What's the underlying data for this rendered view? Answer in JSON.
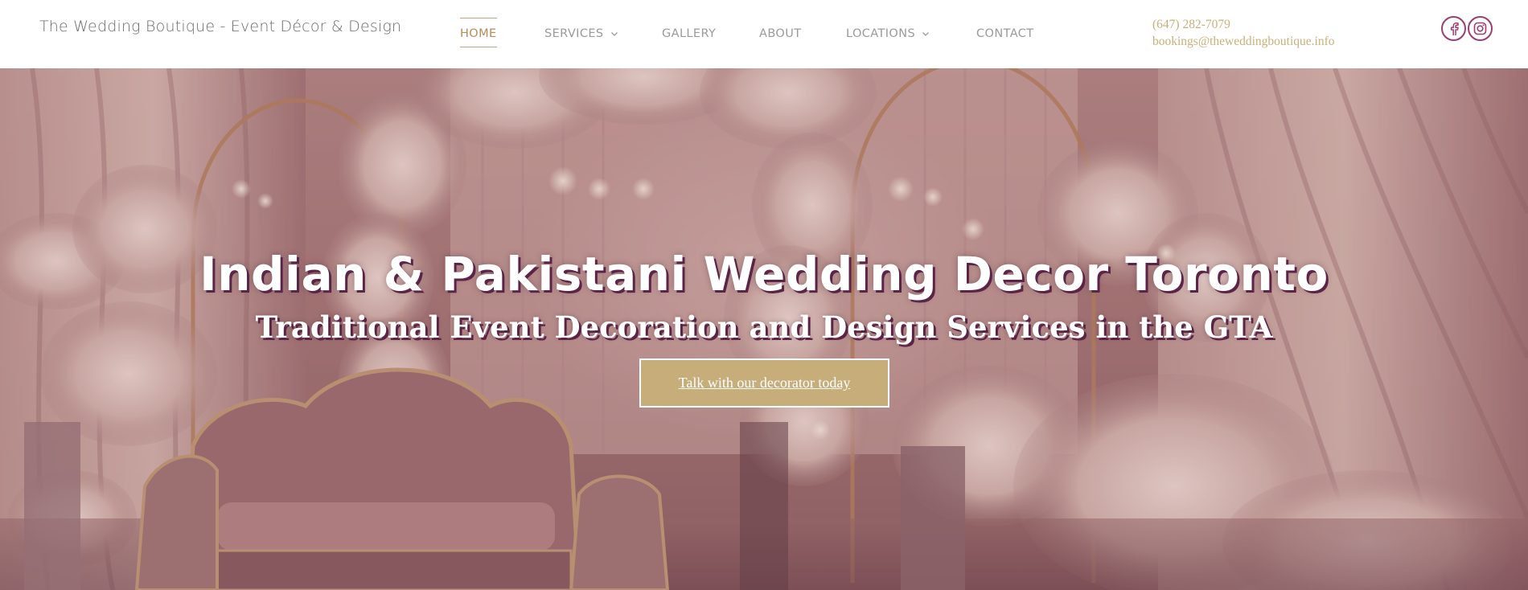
{
  "brand": {
    "title": "The Wedding Boutique - Event Décor & Design"
  },
  "nav": {
    "items": [
      {
        "label": "HOME",
        "active": true,
        "dropdown": false
      },
      {
        "label": "SERVICES",
        "active": false,
        "dropdown": true
      },
      {
        "label": "GALLERY",
        "active": false,
        "dropdown": false
      },
      {
        "label": "ABOUT",
        "active": false,
        "dropdown": false
      },
      {
        "label": "LOCATIONS",
        "active": false,
        "dropdown": true
      },
      {
        "label": "CONTACT",
        "active": false,
        "dropdown": false
      }
    ]
  },
  "contact": {
    "phone": "(647) 282-7079",
    "email": "bookings@theweddingboutique.info"
  },
  "social": [
    {
      "icon": "facebook-icon"
    },
    {
      "icon": "instagram-icon"
    }
  ],
  "hero": {
    "title": "Indian & Pakistani Wedding Decor Toronto",
    "subtitle": "Traditional Event Decoration and Design Services in the GTA",
    "cta_label": "Talk with our decorator today"
  },
  "colors": {
    "accent_gold": "#c6ad7a",
    "social_purple": "#9b3e73",
    "nav_active": "#b88a5a",
    "text_shadow": "#5b2447"
  }
}
